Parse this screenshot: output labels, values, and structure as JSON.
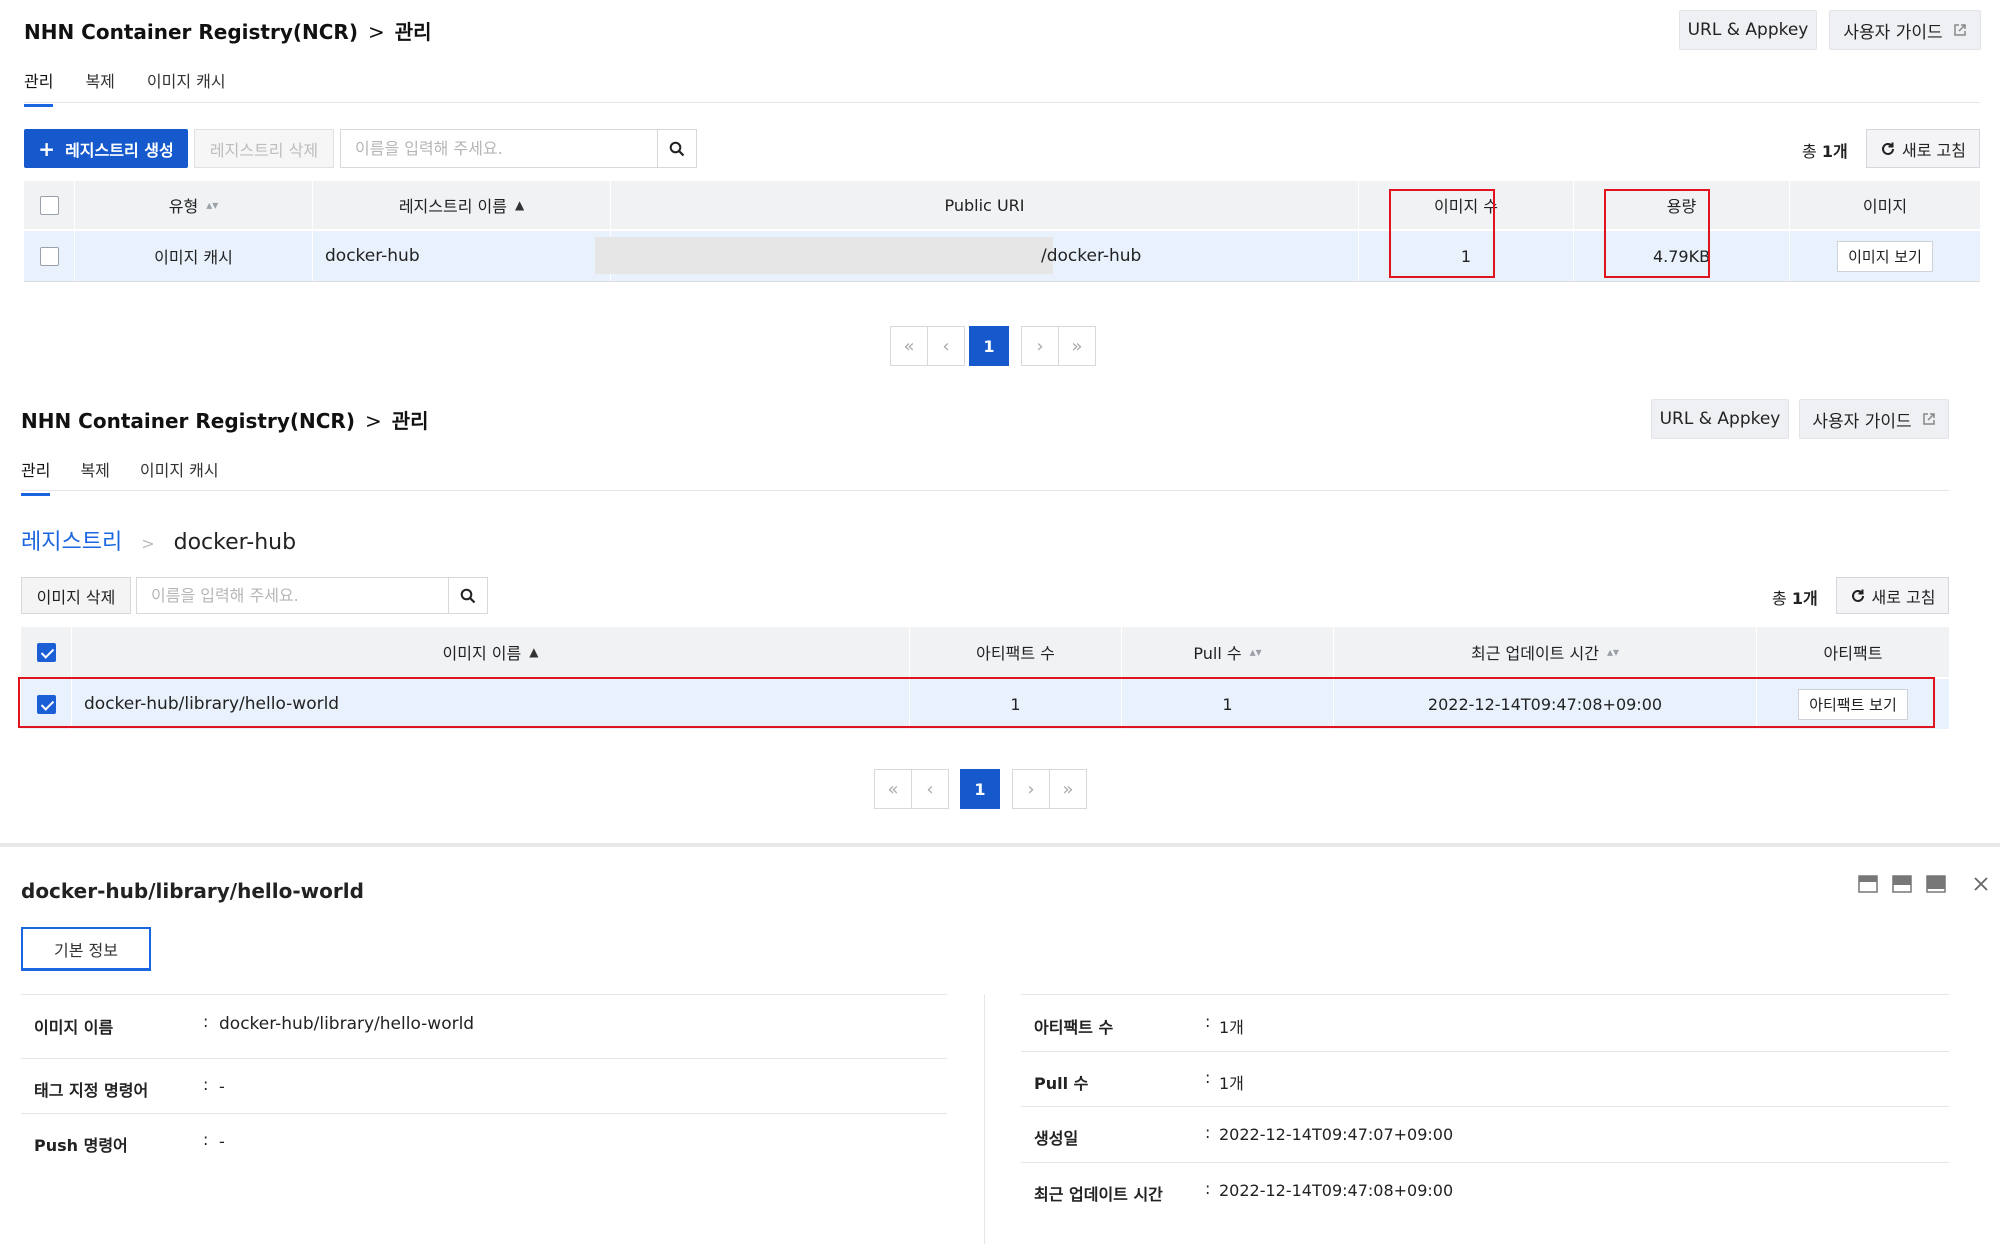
{
  "header": {
    "service": "NHN Container Registry(NCR)",
    "separator": ">",
    "page": "관리",
    "url_appkey": "URL & Appkey",
    "user_guide": "사용자 가이드"
  },
  "tabs": [
    {
      "label": "관리",
      "active": true
    },
    {
      "label": "복제",
      "active": false
    },
    {
      "label": "이미지 캐시",
      "active": false
    }
  ],
  "registry_panel": {
    "create_button": "레지스트리 생성",
    "create_icon": "plus-icon",
    "delete_button": "레지스트리 삭제",
    "search_placeholder": "이름을 입력해 주세요.",
    "total_prefix": "총 ",
    "total_count": "1개",
    "refresh_button": "새로 고침",
    "columns": [
      "유형",
      "레지스트리 이름",
      "Public URI",
      "이미지 수",
      "용량",
      "이미지"
    ],
    "rows": [
      {
        "type": "이미지 캐시",
        "name": "docker-hub",
        "uri_suffix": "/docker-hub",
        "image_count": "1",
        "capacity": "4.79KB",
        "action": "이미지 보기"
      }
    ],
    "pagination": {
      "current": "1"
    }
  },
  "image_panel": {
    "breadcrumb_root": "레지스트리",
    "breadcrumb_sep": ">",
    "registry": "docker-hub",
    "delete_button": "이미지 삭제",
    "search_placeholder": "이름을 입력해 주세요.",
    "total_prefix": "총 ",
    "total_count": "1개",
    "refresh_button": "새로 고침",
    "columns": [
      "이미지 이름",
      "아티팩트 수",
      "Pull 수",
      "최근 업데이트 시간",
      "아티팩트"
    ],
    "rows": [
      {
        "name": "docker-hub/library/hello-world",
        "artifact_count": "1",
        "pull_count": "1",
        "updated": "2022-12-14T09:47:08+09:00",
        "action": "아티팩트 보기"
      }
    ],
    "pagination": {
      "current": "1"
    }
  },
  "detail": {
    "title": "docker-hub/library/hello-world",
    "tab": "기본 정보",
    "colon": ":",
    "left": [
      {
        "label": "이미지 이름",
        "value": "docker-hub/library/hello-world"
      },
      {
        "label": "태그 지정 명령어",
        "value": "-"
      },
      {
        "label": "Push 명령어",
        "value": "-"
      }
    ],
    "right": [
      {
        "label": "아티팩트 수",
        "value": "1개"
      },
      {
        "label": "Pull 수",
        "value": "1개"
      },
      {
        "label": "생성일",
        "value": "2022-12-14T09:47:07+09:00"
      },
      {
        "label": "최근 업데이트 시간",
        "value": "2022-12-14T09:47:08+09:00"
      }
    ]
  },
  "pager_glyphs": {
    "first": "«",
    "prev": "‹",
    "next": "›",
    "last": "»"
  },
  "colors": {
    "accent": "#1559cc",
    "highlight": "#e0141e",
    "selected_row": "#e9f1fd",
    "header_bg": "#f1f2f4"
  }
}
